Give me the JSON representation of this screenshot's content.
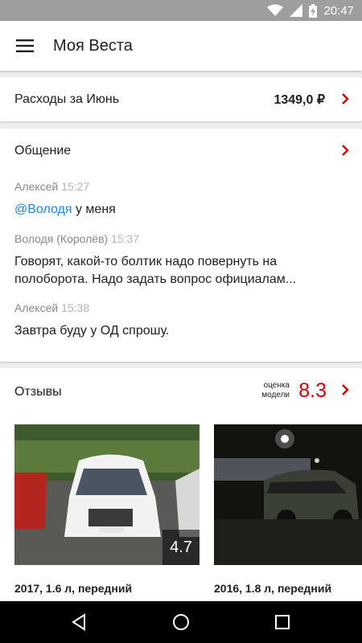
{
  "status_bar": {
    "time": "20:47"
  },
  "app_bar": {
    "title": "Моя Веста"
  },
  "expenses": {
    "label": "Расходы за Июнь",
    "amount": "1349,0 ₽"
  },
  "chat": {
    "title": "Общение",
    "messages": [
      {
        "author": "Алексей",
        "time": "15:27",
        "mention": "@Володя",
        "text": " у меня"
      },
      {
        "author": "Володя (Королёв)",
        "time": "15:37",
        "text": "Говорят, какой-то болтик надо повернуть на полоборота. Надо задать вопрос официалам..."
      },
      {
        "author": "Алексей",
        "time": "15:38",
        "text": "Завтра буду у ОД спрошу."
      }
    ]
  },
  "reviews": {
    "title": "Отзывы",
    "rating_caption_line1": "оценка",
    "rating_caption_line2": "модели",
    "rating_value": "8.3",
    "cars": [
      {
        "score": "4.7",
        "caption": "2017, 1.6 л, передний"
      },
      {
        "caption": "2016, 1.8 л, передний"
      }
    ]
  },
  "colors": {
    "accent": "#d50000",
    "link": "#1e88e5",
    "status_bar": "#9e9e9e"
  }
}
